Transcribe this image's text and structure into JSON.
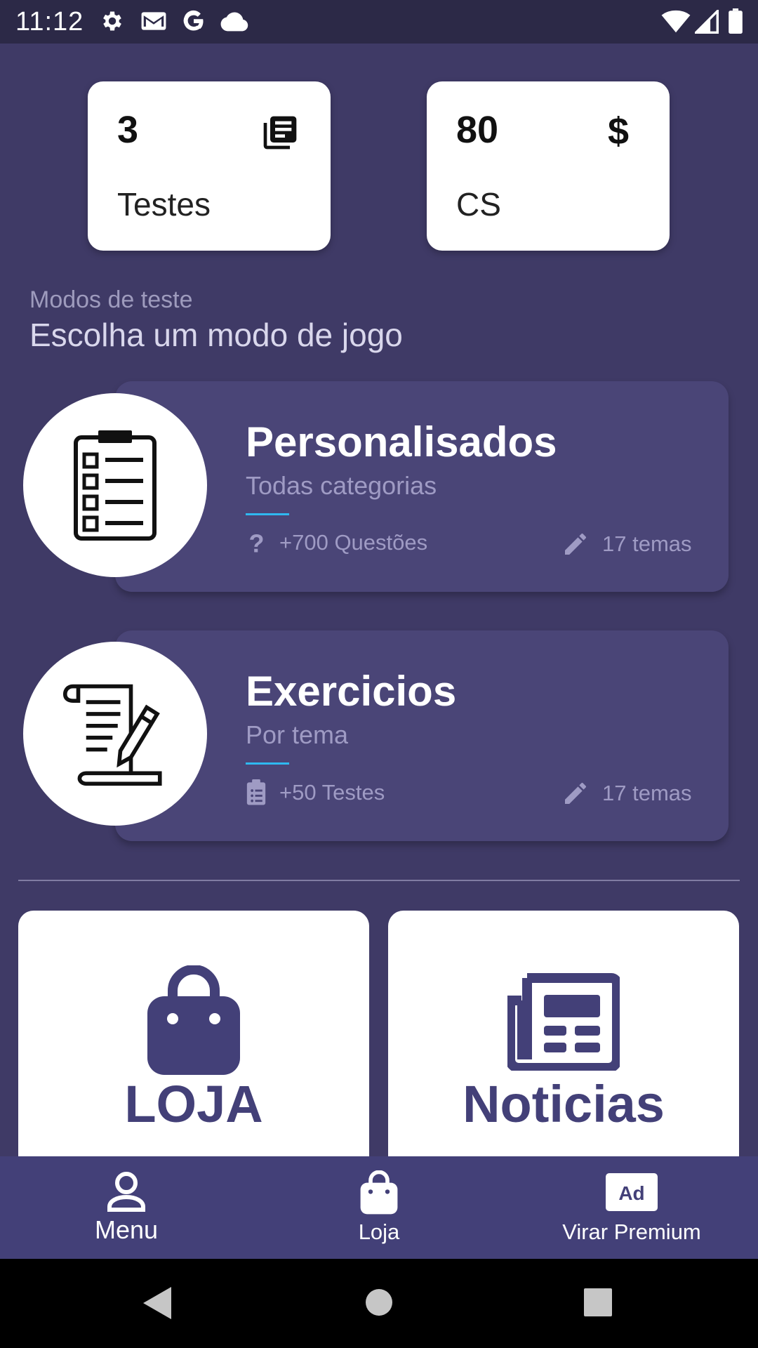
{
  "status_bar": {
    "time": "11:12",
    "icons": [
      "settings-icon",
      "gmail-icon",
      "google-icon",
      "cloud-icon",
      "wifi-icon",
      "signal-icon",
      "battery-icon"
    ]
  },
  "stats": [
    {
      "value": "3",
      "label": "Testes",
      "icon": "book-stack-icon"
    },
    {
      "value": "80",
      "label": "CS",
      "icon": "$"
    }
  ],
  "section": {
    "subtitle": "Modos de teste",
    "title": "Escolha um modo de jogo"
  },
  "modes": [
    {
      "title": "Personalisados",
      "subtitle": "Todas categorias",
      "meta_left": "+700 Questões",
      "meta_right": "17 temas",
      "icon": "checklist-icon"
    },
    {
      "title": "Exercicios",
      "subtitle": "Por tema",
      "meta_left": "+50 Testes",
      "meta_right": "17 temas",
      "icon": "document-pen-icon"
    }
  ],
  "tiles": [
    {
      "label": "LOJA",
      "icon": "shopping-bag-icon"
    },
    {
      "label": "Noticias",
      "icon": "newspaper-icon"
    }
  ],
  "bottom_nav": [
    {
      "label": "Menu",
      "icon": "person-icon"
    },
    {
      "label": "Loja",
      "icon": "shopping-bag-icon"
    },
    {
      "label": "Virar Premium",
      "icon": "ad-icon"
    }
  ],
  "colors": {
    "background": "#3f3a66",
    "card": "#4a4577",
    "accent_line": "#2fb8f0",
    "nav": "#434078",
    "status_bar": "#2c2947"
  }
}
